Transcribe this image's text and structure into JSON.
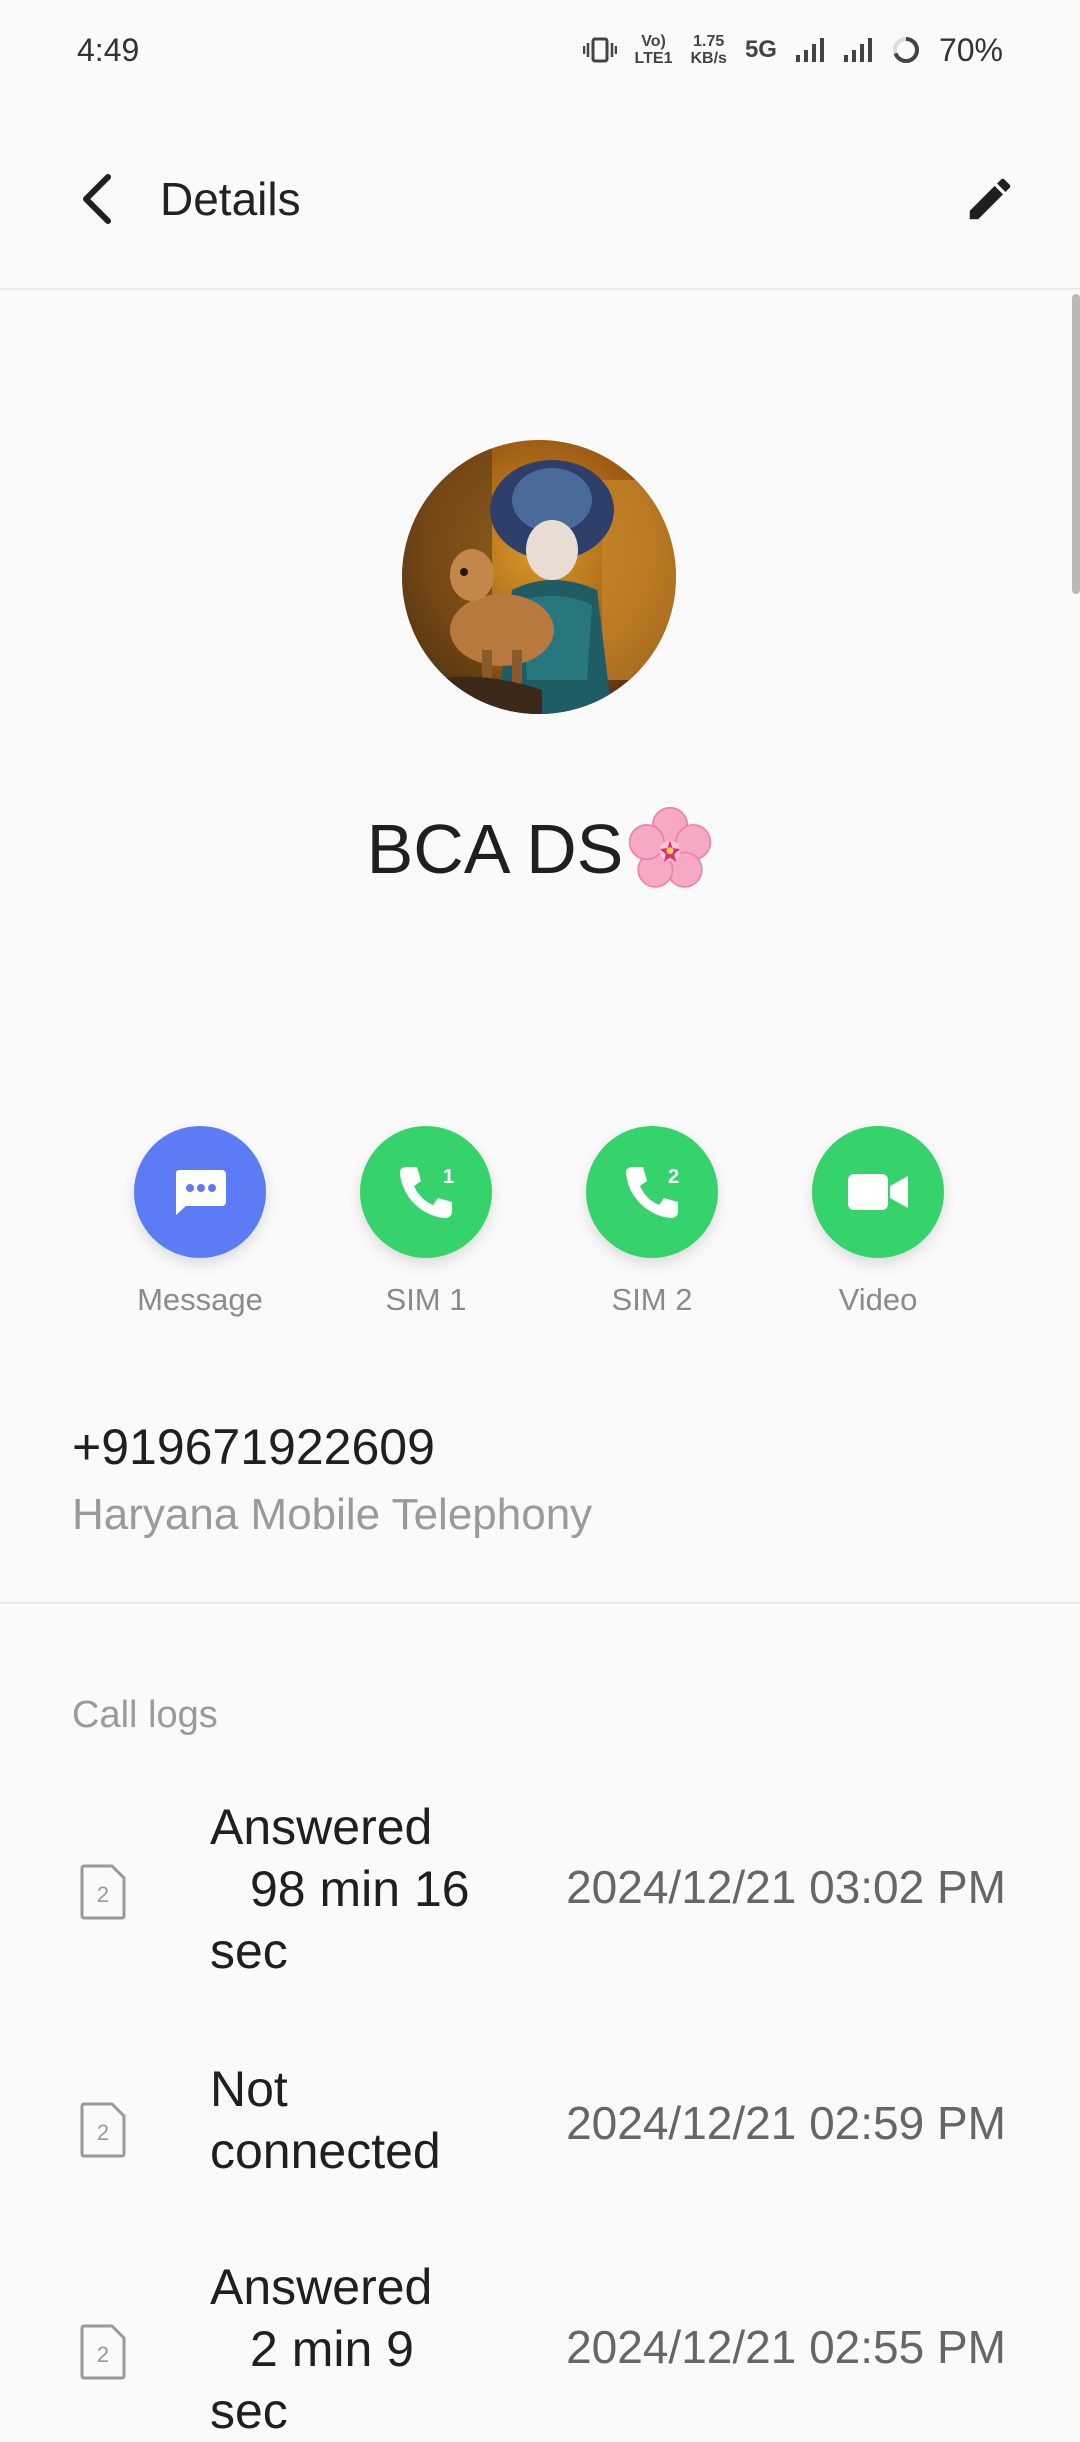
{
  "status_bar": {
    "time": "4:49",
    "volte_top": "Vo)",
    "volte_bottom": "LTE1",
    "speed_value": "1.75",
    "speed_unit": "KB/s",
    "network": "5G",
    "battery": "70%"
  },
  "header": {
    "title": "Details"
  },
  "contact": {
    "name": "BCA DS"
  },
  "actions": [
    {
      "label": "Message",
      "color": "#5b7cf5"
    },
    {
      "label": "SIM 1",
      "color": "#36d36c",
      "badge": "1"
    },
    {
      "label": "SIM 2",
      "color": "#36d36c",
      "badge": "2"
    },
    {
      "label": "Video",
      "color": "#36d36c"
    }
  ],
  "phone": {
    "number": "+919671922609",
    "carrier": "Haryana Mobile Telephony"
  },
  "call_logs": {
    "title": "Call logs",
    "entries": [
      {
        "sim": "2",
        "status_line1": "Answered",
        "status_line2": "98 min 16",
        "status_line3": "sec",
        "datetime": "2024/12/21 03:02 PM"
      },
      {
        "sim": "2",
        "status_line1": "Not",
        "status_line2": "connected",
        "datetime": "2024/12/21 02:59 PM"
      },
      {
        "sim": "2",
        "status_line1": "Answered",
        "status_line2": "2 min 9",
        "status_line3": "sec",
        "datetime": "2024/12/21 02:55 PM"
      }
    ]
  }
}
